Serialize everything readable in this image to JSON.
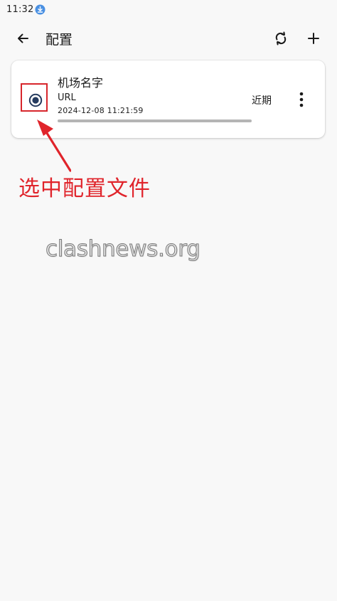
{
  "status_bar": {
    "time": "11:32",
    "download_icon": "download-circle-icon"
  },
  "app_bar": {
    "title": "配置",
    "back_icon": "arrow-left-icon",
    "refresh_icon": "sync-icon",
    "add_icon": "plus-icon"
  },
  "profile": {
    "name": "机场名字",
    "type": "URL",
    "updated": "2024-12-08 11:21:59",
    "expire": "近期",
    "selected": true,
    "progress_fraction": 1.0,
    "more_icon": "more-vertical-icon"
  },
  "annotation": {
    "text": "选中配置文件",
    "color": "#e0242b"
  },
  "watermark": {
    "text": "clashnews.org"
  },
  "colors": {
    "background": "#f8f8f8",
    "card": "#ffffff",
    "radio": "#243a5e",
    "annotation": "#e0242b",
    "status_icon": "#4a90e2"
  }
}
